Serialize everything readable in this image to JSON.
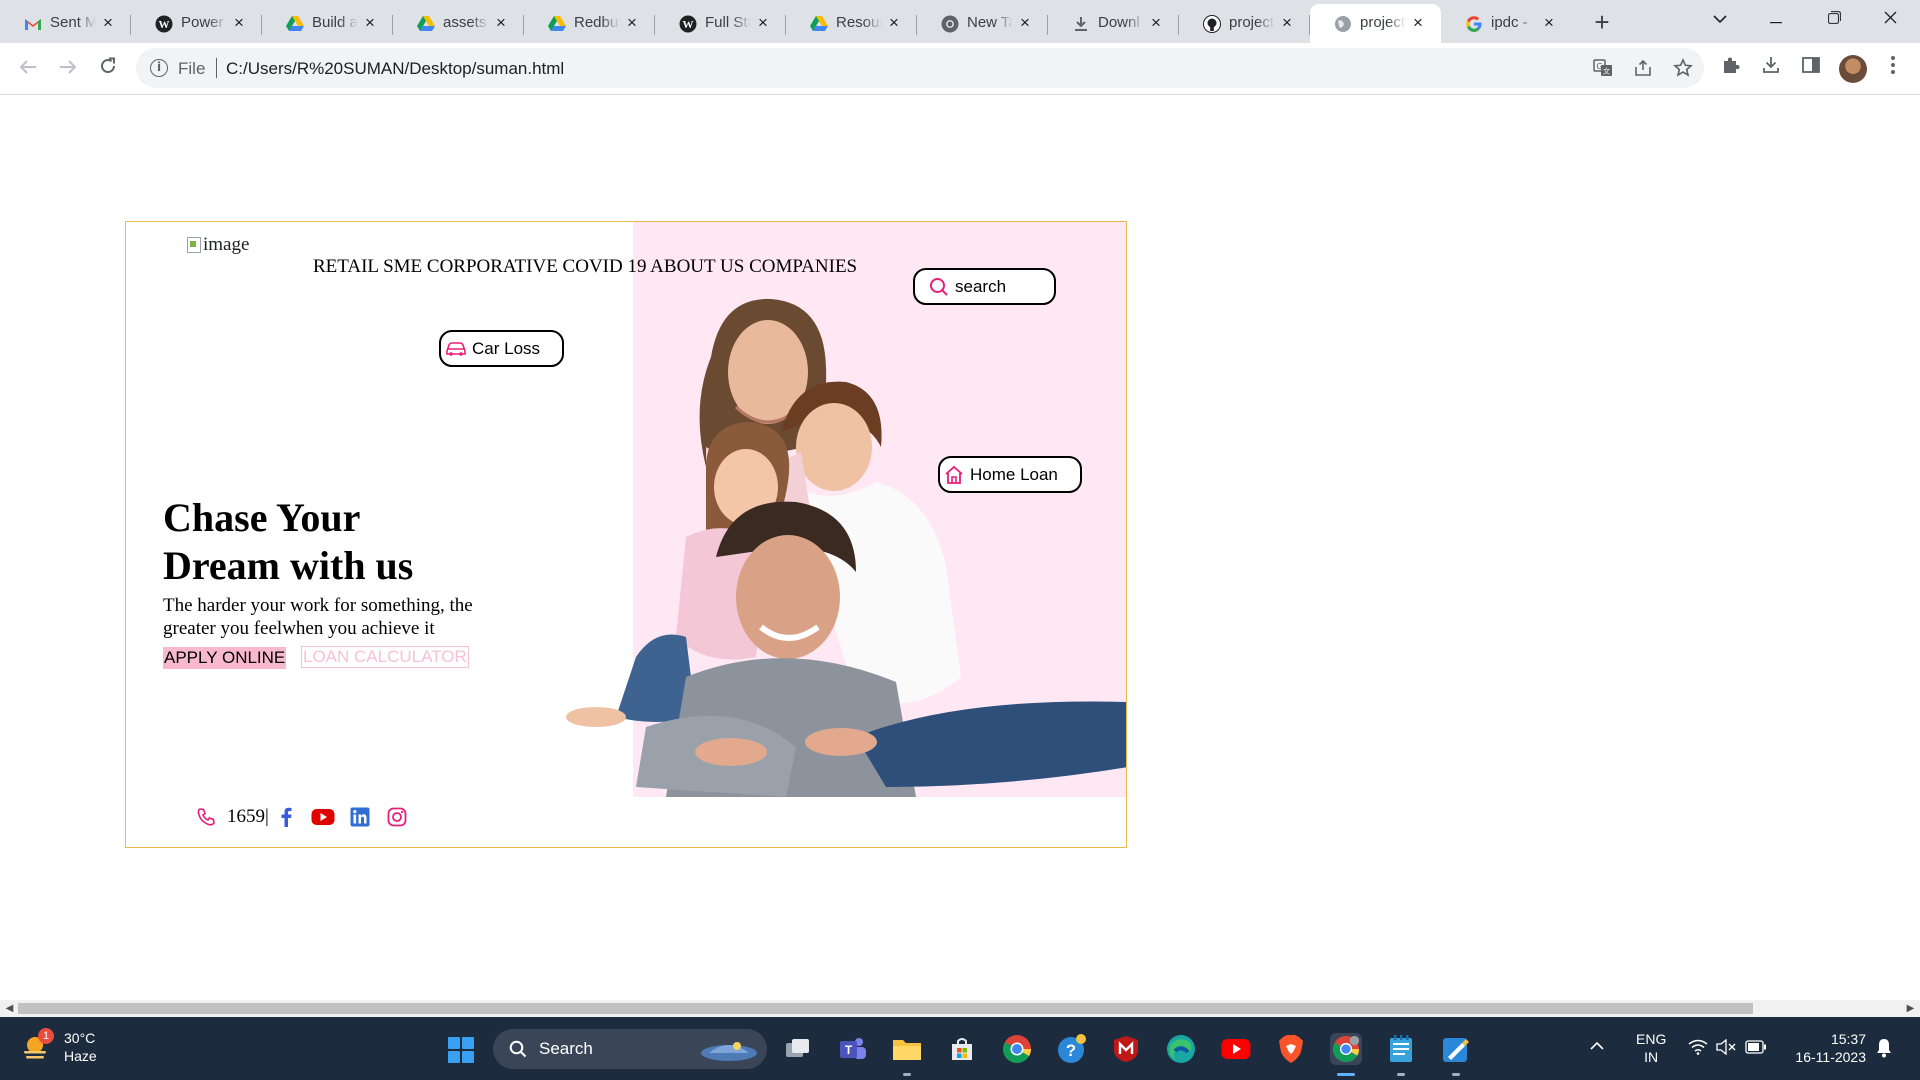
{
  "browser": {
    "tabs": [
      {
        "title": "Sent M",
        "icon": "gmail-icon",
        "active": false
      },
      {
        "title": "Power",
        "icon": "wordpress-icon",
        "active": false
      },
      {
        "title": "Build a",
        "icon": "google-drive-icon",
        "active": false
      },
      {
        "title": "assets",
        "icon": "google-drive-icon",
        "active": false
      },
      {
        "title": "Redbu",
        "icon": "google-drive-icon",
        "active": false
      },
      {
        "title": "Full Sta",
        "icon": "wordpress-icon",
        "active": false
      },
      {
        "title": "Resour",
        "icon": "google-drive-icon",
        "active": false
      },
      {
        "title": "New Ta",
        "icon": "chrome-icon",
        "active": false
      },
      {
        "title": "Downl",
        "icon": "download-icon",
        "active": false
      },
      {
        "title": "project",
        "icon": "github-icon",
        "active": false
      },
      {
        "title": "project",
        "icon": "globe-icon",
        "active": true
      },
      {
        "title": "ipdc - ",
        "icon": "google-icon",
        "active": false
      }
    ],
    "address": {
      "scheme": "File",
      "url": "C:/Users/R%20SUMAN/Desktop/suman.html"
    }
  },
  "site": {
    "logo_alt": "image",
    "nav": [
      "RETAIL",
      "SME",
      "CORPORATIVE",
      "COVID 19",
      "ABOUT US",
      "COMPANIES"
    ],
    "search_label": "search",
    "car_loan_label": "Car Loss",
    "home_loan_label": "Home Loan",
    "heading_line1": "Chase Your",
    "heading_line2": "Dream with us",
    "tagline": "The harder your work for something, the greater you feelwhen you achieve it",
    "apply_label": "APPLY ONLINE",
    "calculator_label": "LOAN CALCULATOR",
    "phone_number": "1659|",
    "social": [
      "facebook-icon",
      "youtube-icon",
      "linkedin-icon",
      "instagram-icon"
    ],
    "accent_color": "#e91e7a",
    "hero_bg_color": "#ffe8f4"
  },
  "taskbar": {
    "weather_temp": "30°C",
    "weather_desc": "Haze",
    "weather_badge": "1",
    "search_label": "Search",
    "lang_line1": "ENG",
    "lang_line2": "IN",
    "time": "15:37",
    "date": "16-11-2023"
  }
}
